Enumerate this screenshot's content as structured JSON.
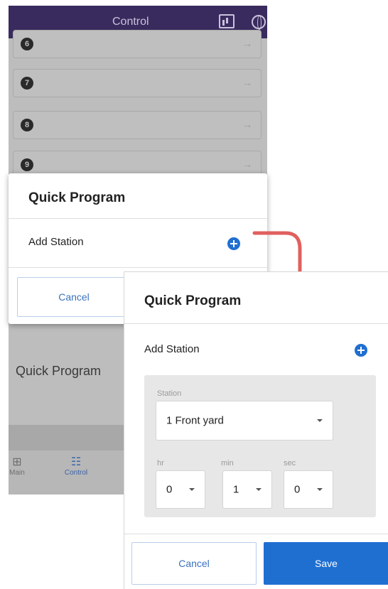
{
  "back_screen": {
    "appbar_title": "Control",
    "rows": [
      {
        "number": "6"
      },
      {
        "number": "7"
      },
      {
        "number": "8"
      },
      {
        "number": "9"
      }
    ],
    "row_arrow": "→",
    "quick_program_text": "Quick Program",
    "nav": {
      "main_label": "Main",
      "control_label": "Control"
    }
  },
  "dialog_small": {
    "title": "Quick Program",
    "add_station_label": "Add Station",
    "cancel_label": "Cancel"
  },
  "dialog_expanded": {
    "title": "Quick Program",
    "add_station_label": "Add Station",
    "station_label": "Station",
    "station_value": "1 Front yard",
    "hr_label": "hr",
    "min_label": "min",
    "sec_label": "sec",
    "hr_value": "0",
    "min_value": "1",
    "sec_value": "0",
    "close_glyph": "✕",
    "cancel_label": "Cancel",
    "save_label": "Save"
  },
  "colors": {
    "appbar": "#3a2b5e",
    "accent": "#1f6fd1",
    "arrow": "#e0605e",
    "overlay": "#bdbdbd"
  }
}
